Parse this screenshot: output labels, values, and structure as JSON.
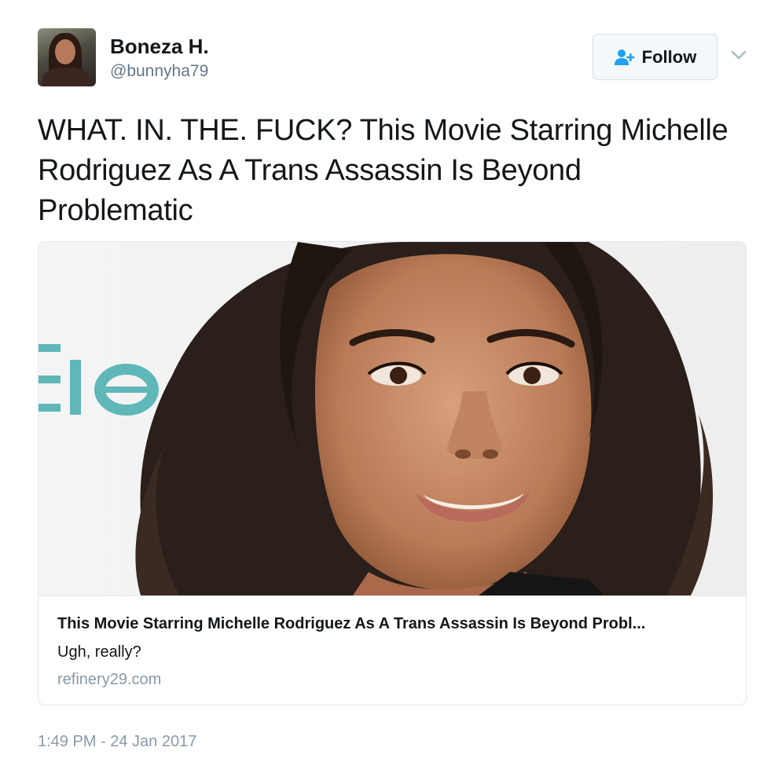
{
  "author": {
    "display_name": "Boneza H.",
    "handle": "@bunnyha79",
    "avatar_icon": "profile-photo"
  },
  "follow_button": {
    "label": "Follow",
    "icon": "add-user-icon",
    "icon_color": "#1da1f2"
  },
  "menu": {
    "icon": "chevron-down-icon"
  },
  "tweet": {
    "text": "WHAT. IN. THE. FUCK? This Movie Starring Michelle Rodriguez As A Trans Assassin Is Beyond Problematic"
  },
  "card": {
    "image_icon": "article-photo",
    "title": "This Movie Starring Michelle Rodriguez As A Trans Assassin Is Beyond Probl...",
    "description": "Ugh, really?",
    "domain": "refinery29.com"
  },
  "meta": {
    "timestamp": "1:49 PM - 24 Jan 2017"
  },
  "colors": {
    "text_primary": "#14171a",
    "text_secondary": "#657786",
    "text_muted": "#8899a6",
    "accent": "#1da1f2",
    "border": "#e1e8ed"
  }
}
